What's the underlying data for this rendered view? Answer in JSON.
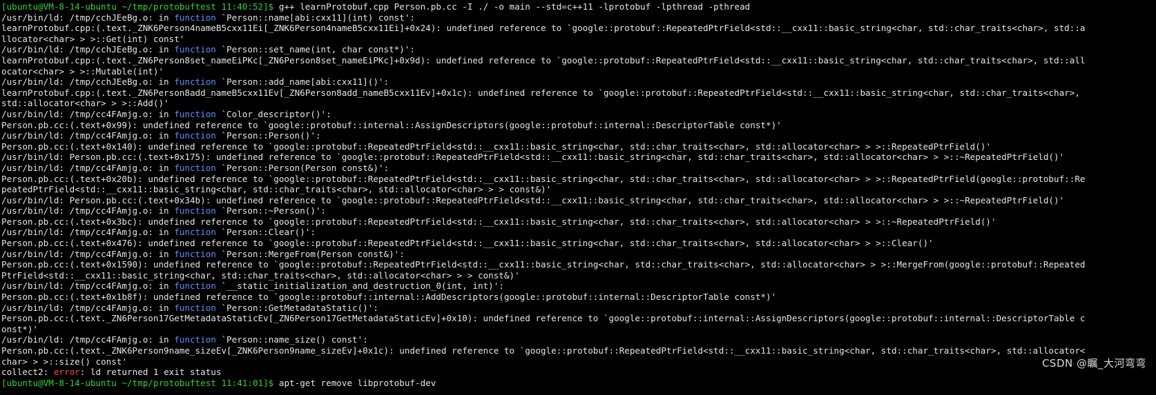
{
  "terminal": {
    "colors": {
      "background": "#000000",
      "text": "#e6e6e6",
      "prompt": "#31d431",
      "keyword": "#5f8fff",
      "error": "#ff4040"
    },
    "prompt_1": "[ubuntu@VM-8-14-ubuntu ~/tmp/protobuftest 11:40:52]$",
    "command_1": "g++ learnProtobuf.cpp Person.pb.cc -I ./ -o main --std=c++11 -lprotobuf -lpthread -pthread",
    "prompt_2": "[ubuntu@VM-8-14-ubuntu ~/tmp/protobuftest 11:41:01]$",
    "command_2": "apt-get remove libprotobuf-dev",
    "lines": [
      {
        "pre": "/usr/bin/ld: /tmp/cchJEeBg.o: in ",
        "kw": "function",
        "post": " `Person::name[abi:cxx11](int) const':"
      },
      {
        "text": "learnProtobuf.cpp:(.text._ZNK6Person4nameB5cxx11Ei[_ZNK6Person4nameB5cxx11Ei]+0x24): undefined reference to `google::protobuf::RepeatedPtrField<std::__cxx11::basic_string<char, std::char_traits<char>, std::a"
      },
      {
        "text": "llocator<char> > >::Get(int) const'"
      },
      {
        "pre": "/usr/bin/ld: /tmp/cchJEeBg.o: in ",
        "kw": "function",
        "post": " `Person::set_name(int, char const*)':"
      },
      {
        "text": "learnProtobuf.cpp:(.text._ZN6Person8set_nameEiPKc[_ZN6Person8set_nameEiPKc]+0x9d): undefined reference to `google::protobuf::RepeatedPtrField<std::__cxx11::basic_string<char, std::char_traits<char>, std::all"
      },
      {
        "text": "ocator<char> > >::Mutable(int)'"
      },
      {
        "pre": "/usr/bin/ld: /tmp/cchJEeBg.o: in ",
        "kw": "function",
        "post": " `Person::add_name[abi:cxx11]()':"
      },
      {
        "text": "learnProtobuf.cpp:(.text._ZN6Person8add_nameB5cxx11Ev[_ZN6Person8add_nameB5cxx11Ev]+0x1c): undefined reference to `google::protobuf::RepeatedPtrField<std::__cxx11::basic_string<char, std::char_traits<char>,"
      },
      {
        "text": "std::allocator<char> > >::Add()'"
      },
      {
        "pre": "/usr/bin/ld: /tmp/cc4FAmjg.o: in ",
        "kw": "function",
        "post": " `Color_descriptor()':"
      },
      {
        "text": "Person.pb.cc:(.text+0x99): undefined reference to `google::protobuf::internal::AssignDescriptors(google::protobuf::internal::DescriptorTable const*)'"
      },
      {
        "pre": "/usr/bin/ld: /tmp/cc4FAmjg.o: in ",
        "kw": "function",
        "post": " `Person::Person()':"
      },
      {
        "text": "Person.pb.cc:(.text+0x140): undefined reference to `google::protobuf::RepeatedPtrField<std::__cxx11::basic_string<char, std::char_traits<char>, std::allocator<char> > >::RepeatedPtrField()'"
      },
      {
        "text": "/usr/bin/ld: Person.pb.cc:(.text+0x175): undefined reference to `google::protobuf::RepeatedPtrField<std::__cxx11::basic_string<char, std::char_traits<char>, std::allocator<char> > >::~RepeatedPtrField()'"
      },
      {
        "pre": "/usr/bin/ld: /tmp/cc4FAmjg.o: in ",
        "kw": "function",
        "post": " `Person::Person(Person const&)':"
      },
      {
        "text": "Person.pb.cc:(.text+0x20b): undefined reference to `google::protobuf::RepeatedPtrField<std::__cxx11::basic_string<char, std::char_traits<char>, std::allocator<char> > >::RepeatedPtrField(google::protobuf::Re"
      },
      {
        "text": "peatedPtrField<std::__cxx11::basic_string<char, std::char_traits<char>, std::allocator<char> > > const&)'"
      },
      {
        "text": "/usr/bin/ld: Person.pb.cc:(.text+0x34b): undefined reference to `google::protobuf::RepeatedPtrField<std::__cxx11::basic_string<char, std::char_traits<char>, std::allocator<char> > >::~RepeatedPtrField()'"
      },
      {
        "pre": "/usr/bin/ld: /tmp/cc4FAmjg.o: in ",
        "kw": "function",
        "post": " `Person::~Person()':"
      },
      {
        "text": "Person.pb.cc:(.text+0x3bc): undefined reference to `google::protobuf::RepeatedPtrField<std::__cxx11::basic_string<char, std::char_traits<char>, std::allocator<char> > >::~RepeatedPtrField()'"
      },
      {
        "pre": "/usr/bin/ld: /tmp/cc4FAmjg.o: in ",
        "kw": "function",
        "post": " `Person::Clear()':"
      },
      {
        "text": "Person.pb.cc:(.text+0x476): undefined reference to `google::protobuf::RepeatedPtrField<std::__cxx11::basic_string<char, std::char_traits<char>, std::allocator<char> > >::Clear()'"
      },
      {
        "pre": "/usr/bin/ld: /tmp/cc4FAmjg.o: in ",
        "kw": "function",
        "post": " `Person::MergeFrom(Person const&)':"
      },
      {
        "text": "Person.pb.cc:(.text+0x1590): undefined reference to `google::protobuf::RepeatedPtrField<std::__cxx11::basic_string<char, std::char_traits<char>, std::allocator<char> > >::MergeFrom(google::protobuf::Repeated"
      },
      {
        "text": "PtrField<std::__cxx11::basic_string<char, std::char_traits<char>, std::allocator<char> > > const&)'"
      },
      {
        "pre": "/usr/bin/ld: /tmp/cc4FAmjg.o: in ",
        "kw": "function",
        "post": " `__static_initialization_and_destruction_0(int, int)':"
      },
      {
        "text": "Person.pb.cc:(.text+0x1b8f): undefined reference to `google::protobuf::internal::AddDescriptors(google::protobuf::internal::DescriptorTable const*)'"
      },
      {
        "pre": "/usr/bin/ld: /tmp/cc4FAmjg.o: in ",
        "kw": "function",
        "post": " `Person::GetMetadataStatic()':"
      },
      {
        "text": "Person.pb.cc:(.text._ZN6Person17GetMetadataStaticEv[_ZN6Person17GetMetadataStaticEv]+0x10): undefined reference to `google::protobuf::internal::AssignDescriptors(google::protobuf::internal::DescriptorTable c"
      },
      {
        "text": "onst*)'"
      },
      {
        "pre": "/usr/bin/ld: /tmp/cc4FAmjg.o: in ",
        "kw": "function",
        "post": " `Person::name_size() const':"
      },
      {
        "text": "Person.pb.cc:(.text._ZNK6Person9name_sizeEv[_ZNK6Person9name_sizeEv]+0x1c): undefined reference to `google::protobuf::RepeatedPtrField<std::__cxx11::basic_string<char, std::char_traits<char>, std::allocator<"
      },
      {
        "text": "char> > >::size() const'"
      }
    ],
    "error_line": {
      "pre": "collect2: ",
      "err": "error",
      "post": ": ld returned 1 exit status"
    },
    "watermark": "CSDN @瞩_大河弯弯"
  }
}
